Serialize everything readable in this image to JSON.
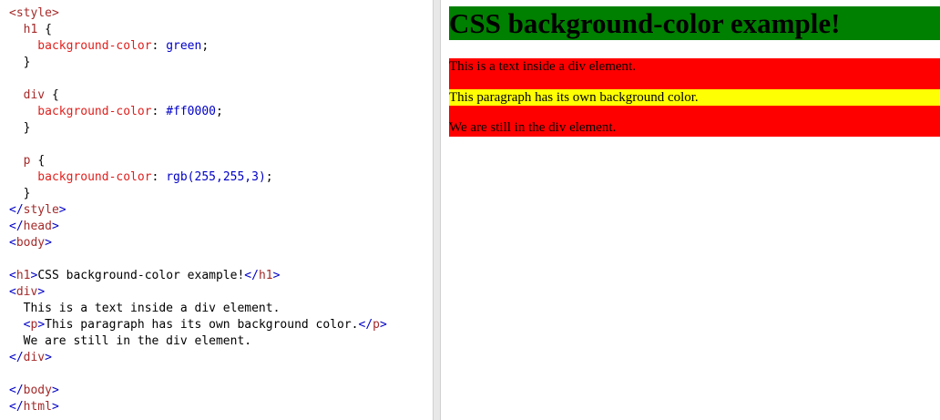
{
  "editor": {
    "lines": [
      [
        {
          "t": "tag",
          "s": "<style>"
        }
      ],
      [
        {
          "t": "tag",
          "s": "  h1 "
        },
        {
          "t": "txt",
          "s": "{"
        }
      ],
      [
        {
          "t": "prop",
          "s": "    background-color"
        },
        {
          "t": "txt",
          "s": ": "
        },
        {
          "t": "val",
          "s": "green"
        },
        {
          "t": "txt",
          "s": ";"
        }
      ],
      [
        {
          "t": "txt",
          "s": "  }"
        }
      ],
      [],
      [
        {
          "t": "tag",
          "s": "  div "
        },
        {
          "t": "txt",
          "s": "{"
        }
      ],
      [
        {
          "t": "prop",
          "s": "    background-color"
        },
        {
          "t": "txt",
          "s": ": "
        },
        {
          "t": "val",
          "s": "#ff0000"
        },
        {
          "t": "txt",
          "s": ";"
        }
      ],
      [
        {
          "t": "txt",
          "s": "  }"
        }
      ],
      [],
      [
        {
          "t": "tag",
          "s": "  p "
        },
        {
          "t": "txt",
          "s": "{"
        }
      ],
      [
        {
          "t": "prop",
          "s": "    background-color"
        },
        {
          "t": "txt",
          "s": ": "
        },
        {
          "t": "val",
          "s": "rgb(255,255,3)"
        },
        {
          "t": "txt",
          "s": ";"
        }
      ],
      [
        {
          "t": "txt",
          "s": "  }"
        }
      ],
      [
        {
          "t": "brk",
          "s": "</"
        },
        {
          "t": "tag",
          "s": "style"
        },
        {
          "t": "brk",
          "s": ">"
        }
      ],
      [
        {
          "t": "brk",
          "s": "</"
        },
        {
          "t": "tag",
          "s": "head"
        },
        {
          "t": "brk",
          "s": ">"
        }
      ],
      [
        {
          "t": "brk",
          "s": "<"
        },
        {
          "t": "tag",
          "s": "body"
        },
        {
          "t": "brk",
          "s": ">"
        }
      ],
      [],
      [
        {
          "t": "brk",
          "s": "<"
        },
        {
          "t": "tag",
          "s": "h1"
        },
        {
          "t": "brk",
          "s": ">"
        },
        {
          "t": "txt",
          "s": "CSS background-color example!"
        },
        {
          "t": "brk",
          "s": "</"
        },
        {
          "t": "tag",
          "s": "h1"
        },
        {
          "t": "brk",
          "s": ">"
        }
      ],
      [
        {
          "t": "brk",
          "s": "<"
        },
        {
          "t": "tag",
          "s": "div"
        },
        {
          "t": "brk",
          "s": ">"
        }
      ],
      [
        {
          "t": "txt",
          "s": "  This is a text inside a div element."
        }
      ],
      [
        {
          "t": "txt",
          "s": "  "
        },
        {
          "t": "brk",
          "s": "<"
        },
        {
          "t": "tag",
          "s": "p"
        },
        {
          "t": "brk",
          "s": ">"
        },
        {
          "t": "txt",
          "s": "This paragraph has its own background color."
        },
        {
          "t": "brk",
          "s": "</"
        },
        {
          "t": "tag",
          "s": "p"
        },
        {
          "t": "brk",
          "s": ">"
        }
      ],
      [
        {
          "t": "txt",
          "s": "  We are still in the div element."
        }
      ],
      [
        {
          "t": "brk",
          "s": "</"
        },
        {
          "t": "tag",
          "s": "div"
        },
        {
          "t": "brk",
          "s": ">"
        }
      ],
      [],
      [
        {
          "t": "brk",
          "s": "</"
        },
        {
          "t": "tag",
          "s": "body"
        },
        {
          "t": "brk",
          "s": ">"
        }
      ],
      [
        {
          "t": "brk",
          "s": "</"
        },
        {
          "t": "tag",
          "s": "html"
        },
        {
          "t": "brk",
          "s": ">"
        }
      ]
    ]
  },
  "preview": {
    "heading": "CSS background-color example!",
    "div_text_1": "This is a text inside a div element.",
    "paragraph": "This paragraph has its own background color.",
    "div_text_2": "We are still in the div element.",
    "colors": {
      "heading_bg": "#008000",
      "div_bg": "#ff0000",
      "paragraph_bg": "#ffff03"
    }
  },
  "colors": {
    "syntax_tag": "#a52a2a",
    "syntax_property": "#e0201d",
    "syntax_value": "#0000c8",
    "syntax_bracket": "#0000c8",
    "syntax_text": "#000000"
  }
}
